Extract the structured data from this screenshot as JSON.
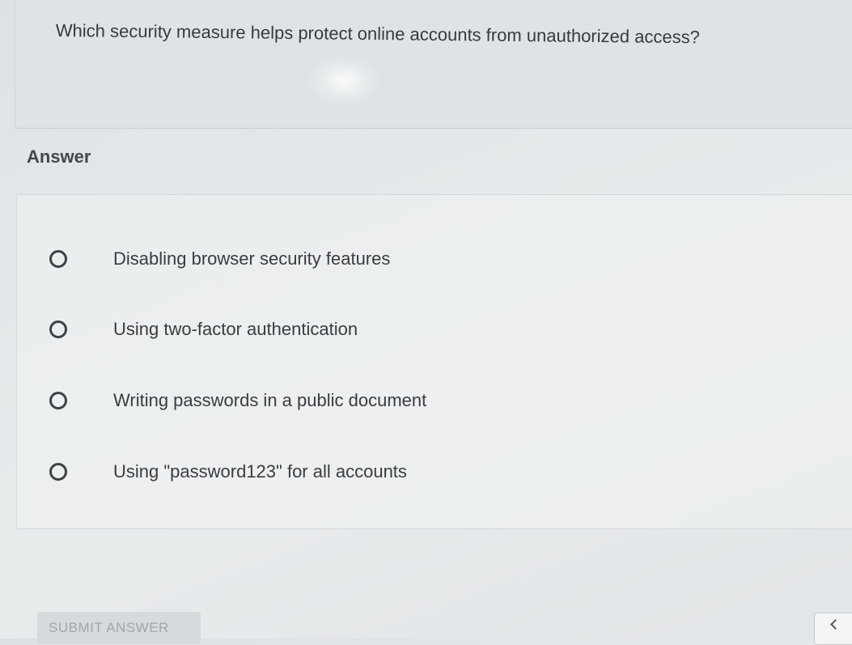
{
  "question": {
    "text": "Which security measure helps protect online accounts from unauthorized access?"
  },
  "answer_section": {
    "heading": "Answer",
    "options": [
      {
        "label": "Disabling browser security features",
        "selected": false
      },
      {
        "label": "Using two-factor authentication",
        "selected": false
      },
      {
        "label": "Writing passwords in a public document",
        "selected": false
      },
      {
        "label": "Using \"password123\" for all accounts",
        "selected": false
      }
    ]
  },
  "actions": {
    "submit_label": "SUBMIT ANSWER",
    "submit_enabled": false
  },
  "side_panel": {
    "toggle_icon": "chevron-left-icon"
  }
}
